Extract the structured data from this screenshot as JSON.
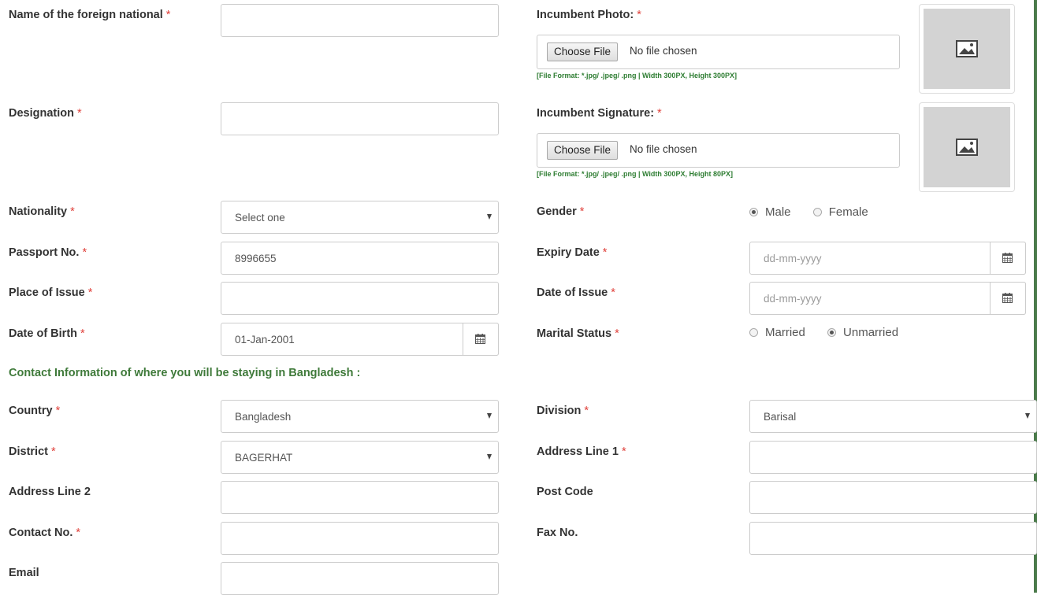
{
  "form": {
    "foreign_name": {
      "label": "Name of the foreign national",
      "req": "*",
      "value": ""
    },
    "designation": {
      "label": "Designation",
      "req": "*",
      "value": ""
    },
    "nationality": {
      "label": "Nationality",
      "req": "*",
      "value": "Select one"
    },
    "passport_no": {
      "label": "Passport No.",
      "req": "*",
      "value": "8996655"
    },
    "place_of_issue": {
      "label": "Place of Issue",
      "req": "*",
      "value": ""
    },
    "date_of_birth": {
      "label": "Date of Birth",
      "req": "*",
      "value": "01-Jan-2001"
    },
    "incumbent_photo": {
      "label": "Incumbent Photo:",
      "req": "*",
      "button": "Choose File",
      "status": "No file chosen",
      "hint": "[File Format: *.jpg/ .jpeg/ .png | Width 300PX, Height 300PX]",
      "icon": "image-placeholder-icon"
    },
    "incumbent_signature": {
      "label": "Incumbent Signature:",
      "req": "*",
      "button": "Choose File",
      "status": "No file chosen",
      "hint": "[File Format: *.jpg/ .jpeg/ .png | Width 300PX, Height 80PX]",
      "icon": "image-placeholder-icon"
    },
    "gender": {
      "label": "Gender",
      "req": "*",
      "options": [
        "Male",
        "Female"
      ],
      "selected": "Male"
    },
    "expiry_date": {
      "label": "Expiry Date",
      "req": "*",
      "placeholder": "dd-mm-yyyy"
    },
    "date_of_issue": {
      "label": "Date of Issue",
      "req": "*",
      "placeholder": "dd-mm-yyyy"
    },
    "marital_status": {
      "label": "Marital Status",
      "req": "*",
      "options": [
        "Married",
        "Unmarried"
      ],
      "selected": "Unmarried"
    }
  },
  "contact": {
    "section_title": "Contact Information of where you will be staying in Bangladesh :",
    "country": {
      "label": "Country",
      "req": "*",
      "value": "Bangladesh"
    },
    "district": {
      "label": "District",
      "req": "*",
      "value": "BAGERHAT"
    },
    "address_line_2": {
      "label": "Address Line 2",
      "value": ""
    },
    "contact_no": {
      "label": "Contact No.",
      "req": "*",
      "value": ""
    },
    "email": {
      "label": "Email",
      "value": ""
    },
    "division": {
      "label": "Division",
      "req": "*",
      "value": "Barisal"
    },
    "address_line_1": {
      "label": "Address Line 1",
      "req": "*",
      "value": ""
    },
    "post_code": {
      "label": "Post Code",
      "value": ""
    },
    "fax_no": {
      "label": "Fax No.",
      "value": ""
    }
  },
  "colors": {
    "required": "#e0403a",
    "section": "#3f7a3a",
    "hint": "#2e7d32",
    "border": "#cccccc"
  }
}
